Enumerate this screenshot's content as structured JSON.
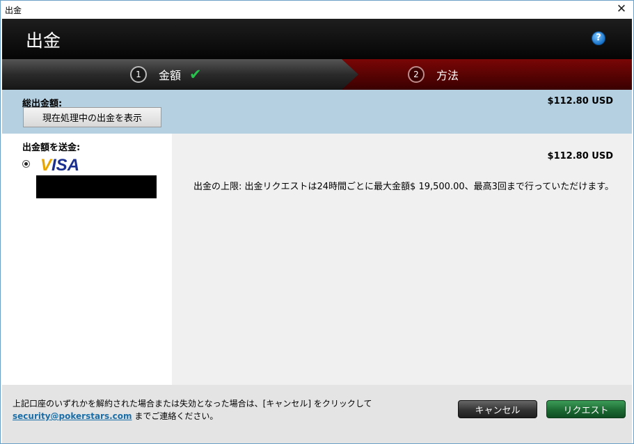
{
  "window": {
    "title": "出金",
    "close_glyph": "✕"
  },
  "header": {
    "title": "出金",
    "help_glyph": "?"
  },
  "steps": [
    {
      "number": "1",
      "label": "金額",
      "completed": true
    },
    {
      "number": "2",
      "label": "方法",
      "completed": false
    }
  ],
  "check_glyph": "✔",
  "total": {
    "label": "総出金額:",
    "amount": "$112.80 USD",
    "pending_button": "現在処理中の出金を表示"
  },
  "method": {
    "label": "出金額を送金:",
    "card_brand": "VISA",
    "selected": true
  },
  "detail": {
    "amount": "$112.80 USD",
    "limit_text": "出金の上限: 出金リクエストは24時間ごとに最大金額$ 19,500.00、最高3回まで行っていただけます。"
  },
  "footer": {
    "note_line1": "上記口座のいずれかを解約された場合または失効となった場合は、[キャンセル] をクリックして",
    "email": "security@pokerstars.com",
    "note_line2_suffix": " までご連絡ください。",
    "cancel_label": "キャンセル",
    "request_label": "リクエスト"
  },
  "colors": {
    "header_bg": "#0a0a0a",
    "step_active_bg": "#7a0606",
    "total_bar_bg": "#b4d0e1",
    "request_button": "#1c6a33",
    "link": "#1a6ea8"
  }
}
